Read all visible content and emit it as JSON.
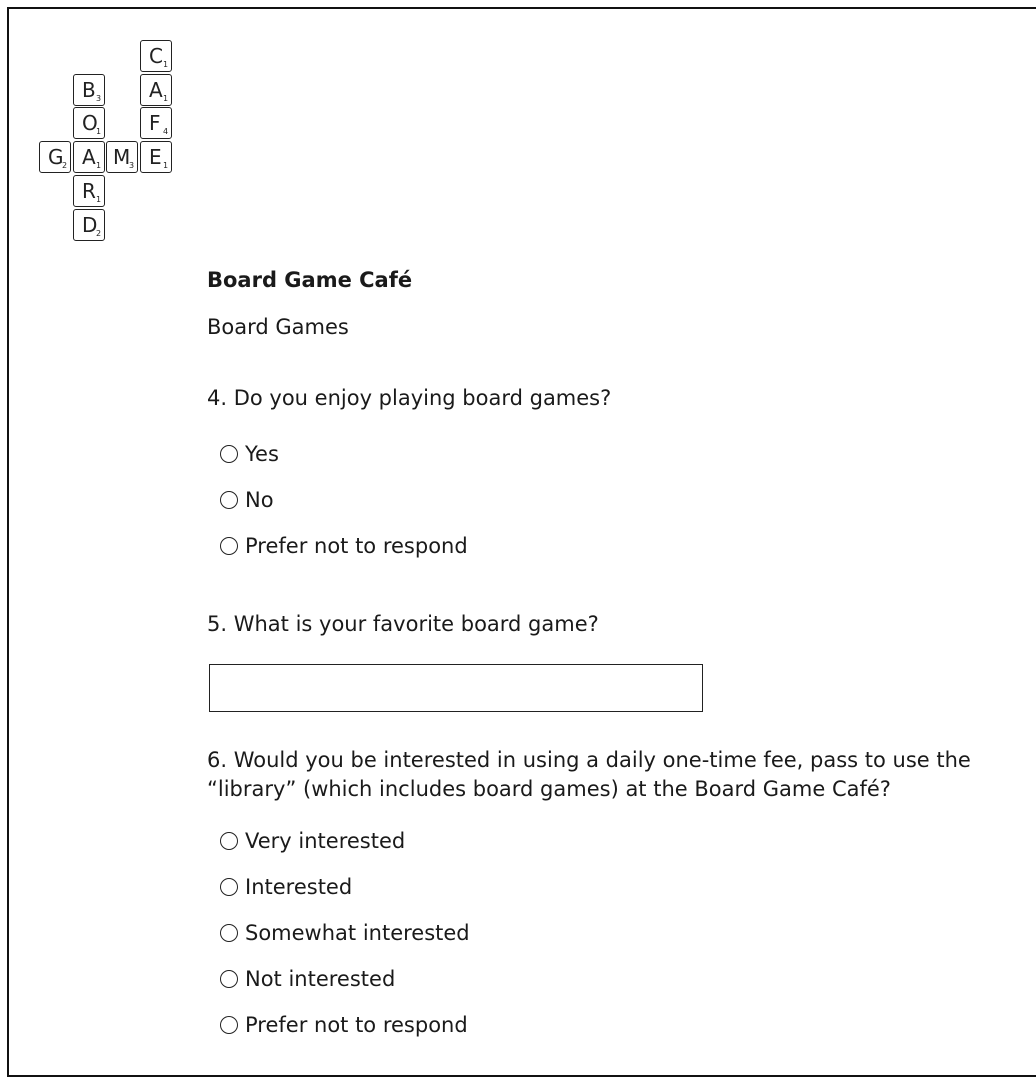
{
  "logo": {
    "tiles": [
      {
        "letter": "C",
        "points": "1"
      },
      {
        "letter": "B",
        "points": "3"
      },
      {
        "letter": "A",
        "points": "1"
      },
      {
        "letter": "O",
        "points": "1"
      },
      {
        "letter": "F",
        "points": "4"
      },
      {
        "letter": "G",
        "points": "2"
      },
      {
        "letter": "A",
        "points": "1"
      },
      {
        "letter": "M",
        "points": "3"
      },
      {
        "letter": "E",
        "points": "1"
      },
      {
        "letter": "R",
        "points": "1"
      },
      {
        "letter": "D",
        "points": "2"
      }
    ]
  },
  "header": {
    "title": "Board Game Café",
    "section": "Board Games"
  },
  "q4": {
    "text": "4. Do you enjoy playing board games?",
    "options": [
      "Yes",
      "No",
      "Prefer not to respond"
    ]
  },
  "q5": {
    "text": "5. What is your favorite board game?",
    "value": ""
  },
  "q6": {
    "text": "6. Would you be interested in using a daily one-time fee, pass to use the “library” (which includes board games) at the Board Game Café?",
    "options": [
      "Very interested",
      "Interested",
      "Somewhat interested",
      "Not interested",
      "Prefer not to respond"
    ]
  }
}
